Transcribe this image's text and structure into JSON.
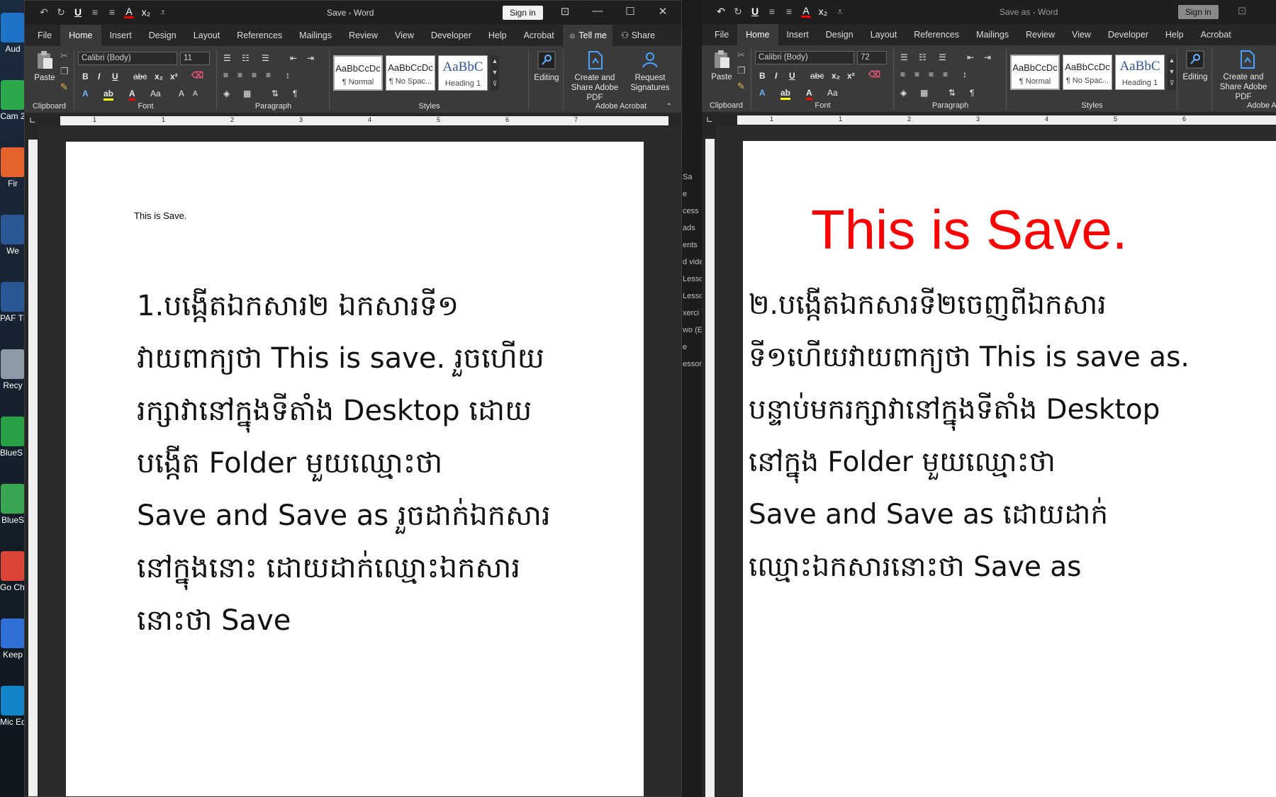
{
  "desktop": {
    "icons": [
      {
        "label": "Aud",
        "color": "#1e73c8"
      },
      {
        "label": "Cam 2",
        "color": "#2aa84a"
      },
      {
        "label": "Fir",
        "color": "#e6612b"
      },
      {
        "label": "We",
        "color": "#2b5797"
      },
      {
        "label": "PAF TEAC",
        "color": "#2b5797"
      },
      {
        "label": "Recy",
        "color": "#8a9aa6"
      },
      {
        "label": "BlueS Multi",
        "color": "#27a046"
      },
      {
        "label": "BlueS",
        "color": "#3aa550"
      },
      {
        "label": "Go Chr",
        "color": "#dc4437"
      },
      {
        "label": "Keep",
        "color": "#2f6fd6"
      },
      {
        "label": "Mic Ed",
        "color": "#1384c9"
      }
    ]
  },
  "left_window": {
    "title": "Save  -  Word",
    "signin_label": "Sign in",
    "tabs": [
      "File",
      "Home",
      "Insert",
      "Design",
      "Layout",
      "References",
      "Mailings",
      "Review",
      "View",
      "Developer",
      "Help",
      "Acrobat"
    ],
    "tell_me": "Tell me",
    "share": "Share",
    "clipboard": {
      "paste": "Paste",
      "label": "Clipboard"
    },
    "font": {
      "name": "Calibri (Body)",
      "size": "11",
      "label": "Font"
    },
    "paragraph_label": "Paragraph",
    "styles": {
      "normal": "¶ Normal",
      "nospacing": "¶ No Spac...",
      "heading": "Heading 1",
      "preview": "AaBbCcDc",
      "heading_preview": "AaBbC",
      "label": "Styles"
    },
    "editing": "Editing",
    "acrobat": {
      "create": "Create and Share Adobe PDF",
      "request": "Request Signatures",
      "label": "Adobe Acrobat"
    },
    "ruler_numbers": [
      "1",
      "1",
      "2",
      "3",
      "4",
      "5",
      "6",
      "7"
    ],
    "doc": {
      "small_text": "This is Save.",
      "lines": [
        "1.បង្កើតឯកសារ២ ឯកសារទី១",
        "វាយពាក្យថា This is save. រួចហើយ",
        "រក្សាវានៅក្នុងទីតាំង Desktop ដោយ",
        "បង្កើត Folder មួយឈ្មោះថា",
        "Save and Save as រួចដាក់ឯកសារ",
        "នៅក្នុងនោះ ដោយដាក់ឈ្មោះឯកសារ",
        "នោះថា Save"
      ]
    }
  },
  "right_window": {
    "title": "Save as  -  Word",
    "signin_label": "Sign in",
    "tabs": [
      "File",
      "Home",
      "Insert",
      "Design",
      "Layout",
      "References",
      "Mailings",
      "Review",
      "View",
      "Developer",
      "Help",
      "Acrobat"
    ],
    "clipboard": {
      "paste": "Paste",
      "label": "Clipboard"
    },
    "font": {
      "name": "Calibri (Body)",
      "size": "72",
      "label": "Font"
    },
    "paragraph_label": "Paragraph",
    "styles": {
      "normal": "¶ Normal",
      "nospacing": "¶ No Spac...",
      "heading": "Heading 1",
      "preview": "AaBbCcDc",
      "heading_preview": "AaBbC",
      "label": "Styles"
    },
    "editing": "Editing",
    "acrobat": {
      "create": "Create and Share Adobe PDF",
      "label": "Adobe A"
    },
    "ruler_numbers": [
      "1",
      "1",
      "2",
      "3",
      "4",
      "5",
      "6"
    ],
    "doc": {
      "heading_text": "This is Save.",
      "heading_color": "#ff0000",
      "lines": [
        "២.បង្កើតឯកសារទី២ចេញពីឯកសារ",
        "ទី១ហើយវាយពាក្យថា This is save as.",
        "បន្ទាប់មករក្សាវានៅក្នុងទីតាំង Desktop",
        "នៅក្នុង Folder មួយឈ្មោះថា",
        "Save and Save as ដោយដាក់",
        "ឈ្មោះឯកសារនោះថា Save as"
      ]
    }
  },
  "background_window": {
    "fragments": [
      "Sa",
      "e",
      "cess",
      "ads",
      "ents",
      "d vide",
      "Lesso",
      "Lesson",
      "xerci",
      "wo (E",
      "e",
      "esson"
    ]
  }
}
